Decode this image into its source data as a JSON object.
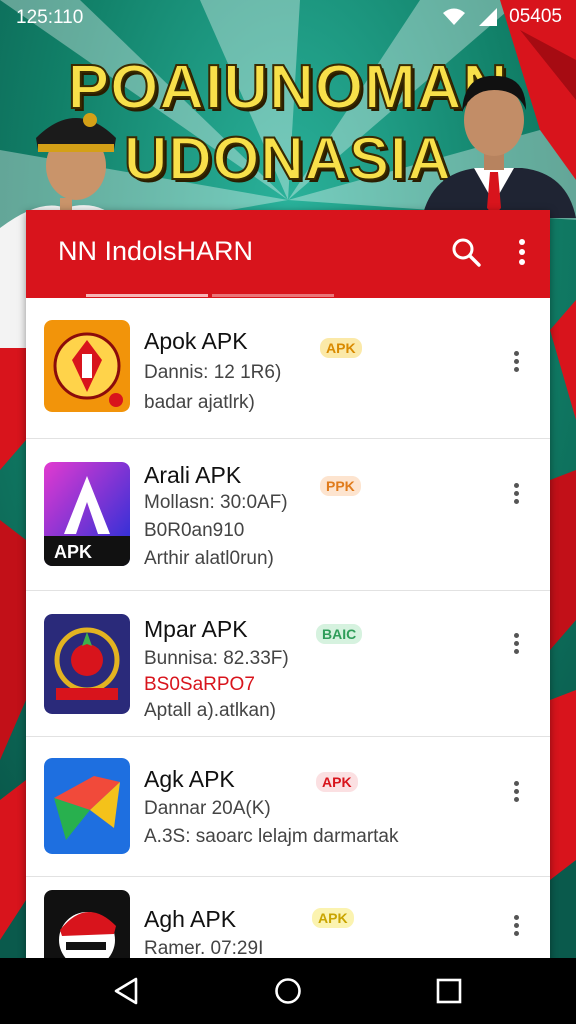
{
  "status_bar": {
    "time": "125:110",
    "right_text": "05405"
  },
  "banner": {
    "line1": "POAIUNOMAN",
    "line2": "UDONASIA"
  },
  "toolbar": {
    "title": "NN IndolsHARN",
    "search_icon": "search-icon",
    "more_icon": "more-vert-icon"
  },
  "apps": [
    {
      "name": "Apok APK",
      "line1": "Dannis: 12 1R6)",
      "line2": "badar ajatlrk)",
      "line3": "",
      "badge": "APK",
      "badge_bg": "#fbe9a8",
      "badge_fg": "#d98a00"
    },
    {
      "name": "Arali APK",
      "line1": "Mollasn: 30:0AF)",
      "line2": "B0R0an910",
      "line3": "Arthir alatl0run)",
      "badge": "PPK",
      "badge_bg": "#fde4cf",
      "badge_fg": "#e07b1b"
    },
    {
      "name": "Mpar APK",
      "line1": "Bunnisa: 82.33F)",
      "line2": "BS0SaRPO7",
      "line3": "Aptall a).atlkan)",
      "badge": "BAIC",
      "badge_bg": "#d6f2df",
      "badge_fg": "#2f9d59"
    },
    {
      "name": "Agk APK",
      "line1": "Dannar 20A(K)",
      "line2": "A.3S: saoarc lelajm darmartak",
      "line3": "",
      "badge": "APK",
      "badge_bg": "#fbe0e2",
      "badge_fg": "#d8141c"
    },
    {
      "name": "Agh APK",
      "line1": "Ramer. 07:29I",
      "line2": "",
      "line3": "",
      "badge": "APK",
      "badge_bg": "#fbf3b0",
      "badge_fg": "#c9a400"
    }
  ],
  "nav": {
    "back": "back-icon",
    "home": "home-icon",
    "recents": "recents-icon"
  }
}
